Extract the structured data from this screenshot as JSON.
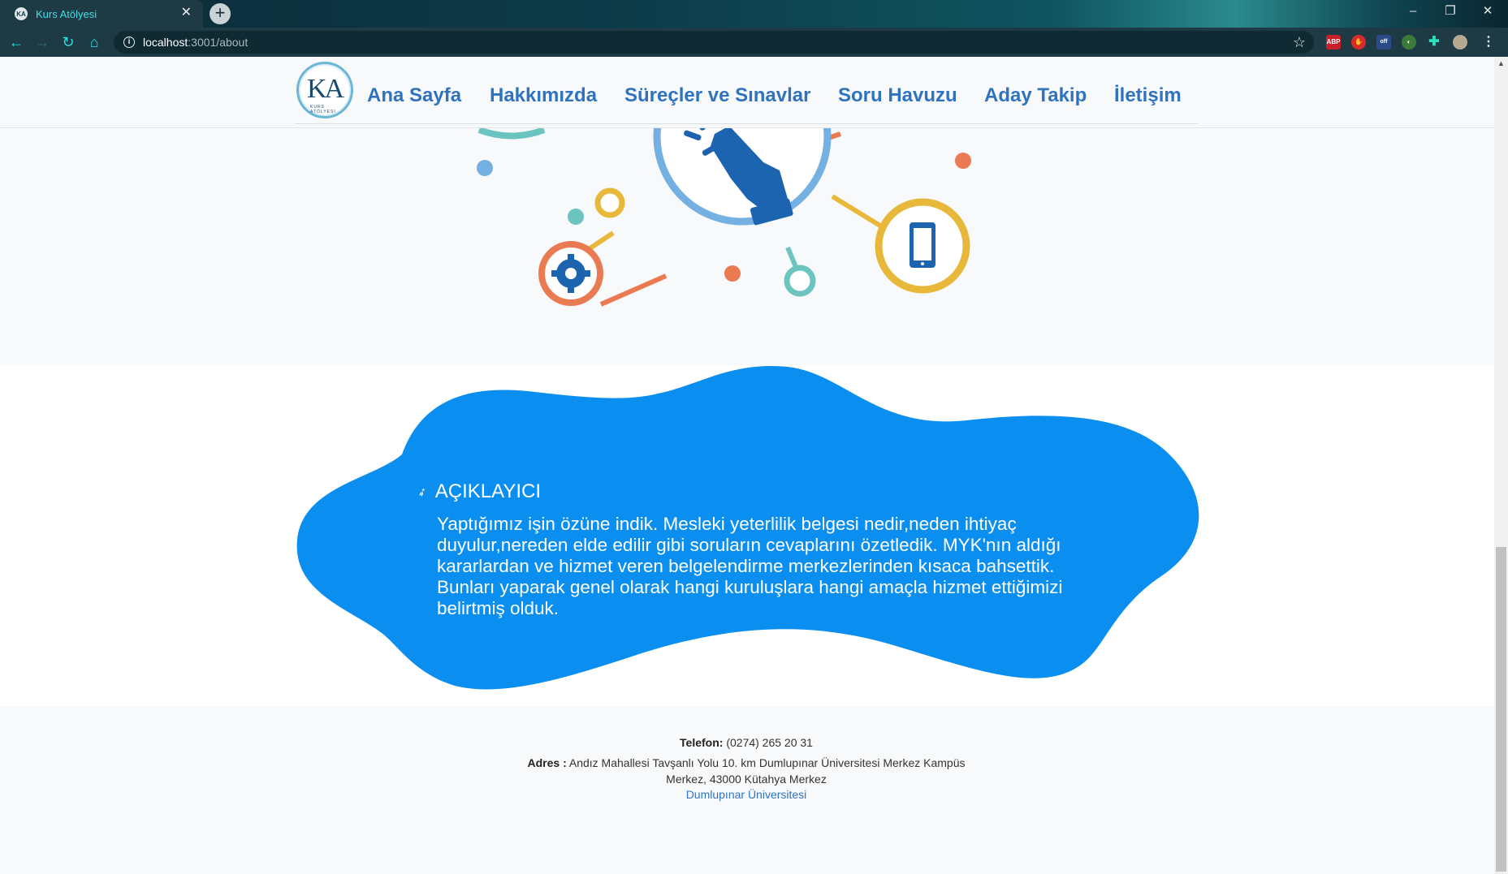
{
  "browser": {
    "tab_title": "Kurs Atölyesi",
    "tab_favicon": "KA",
    "url_host": "localhost",
    "url_path": ":3001/about",
    "extensions": [
      "ABP",
      "off"
    ]
  },
  "navbar": {
    "logo_text": "KA",
    "logo_sub": "KURS ATÖLYESİ",
    "links": [
      {
        "label": "Ana Sayfa"
      },
      {
        "label": "Hakkımızda"
      },
      {
        "label": "Süreçler ve Sınavlar"
      },
      {
        "label": "Soru Havuzu"
      },
      {
        "label": "Aday Takip"
      },
      {
        "label": "İletişim"
      }
    ]
  },
  "about": {
    "title": "AÇIKLAYICI",
    "icon": "rocket-icon",
    "text": "Yaptığımız işin özüne indik. Mesleki yeterlilik belgesi nedir,neden ihtiyaç duyulur,nereden elde edilir gibi soruların cevaplarını özetledik. MYK'nın aldığı kararlardan ve hizmet veren belgelendirme merkezlerinden kısaca bahsettik. Bunları yaparak genel olarak hangi kuruluşlara hangi amaçla hizmet ettiğimizi belirtmiş olduk."
  },
  "footer": {
    "phone_label": "Telefon:",
    "phone_value": "(0274) 265 20 31",
    "address_label": "Adres :",
    "address_line1": "Andız Mahallesi Tavşanlı Yolu 10. km Dumlupınar Üniversitesi Merkez Kampüs",
    "address_line2": "Merkez, 43000 Kütahya Merkez",
    "link": "Dumlupınar Üniversitesi"
  },
  "colors": {
    "nav_link": "#2f73c0",
    "blob": "#0a8ef0",
    "hero_bg": "#f8f9fa"
  }
}
